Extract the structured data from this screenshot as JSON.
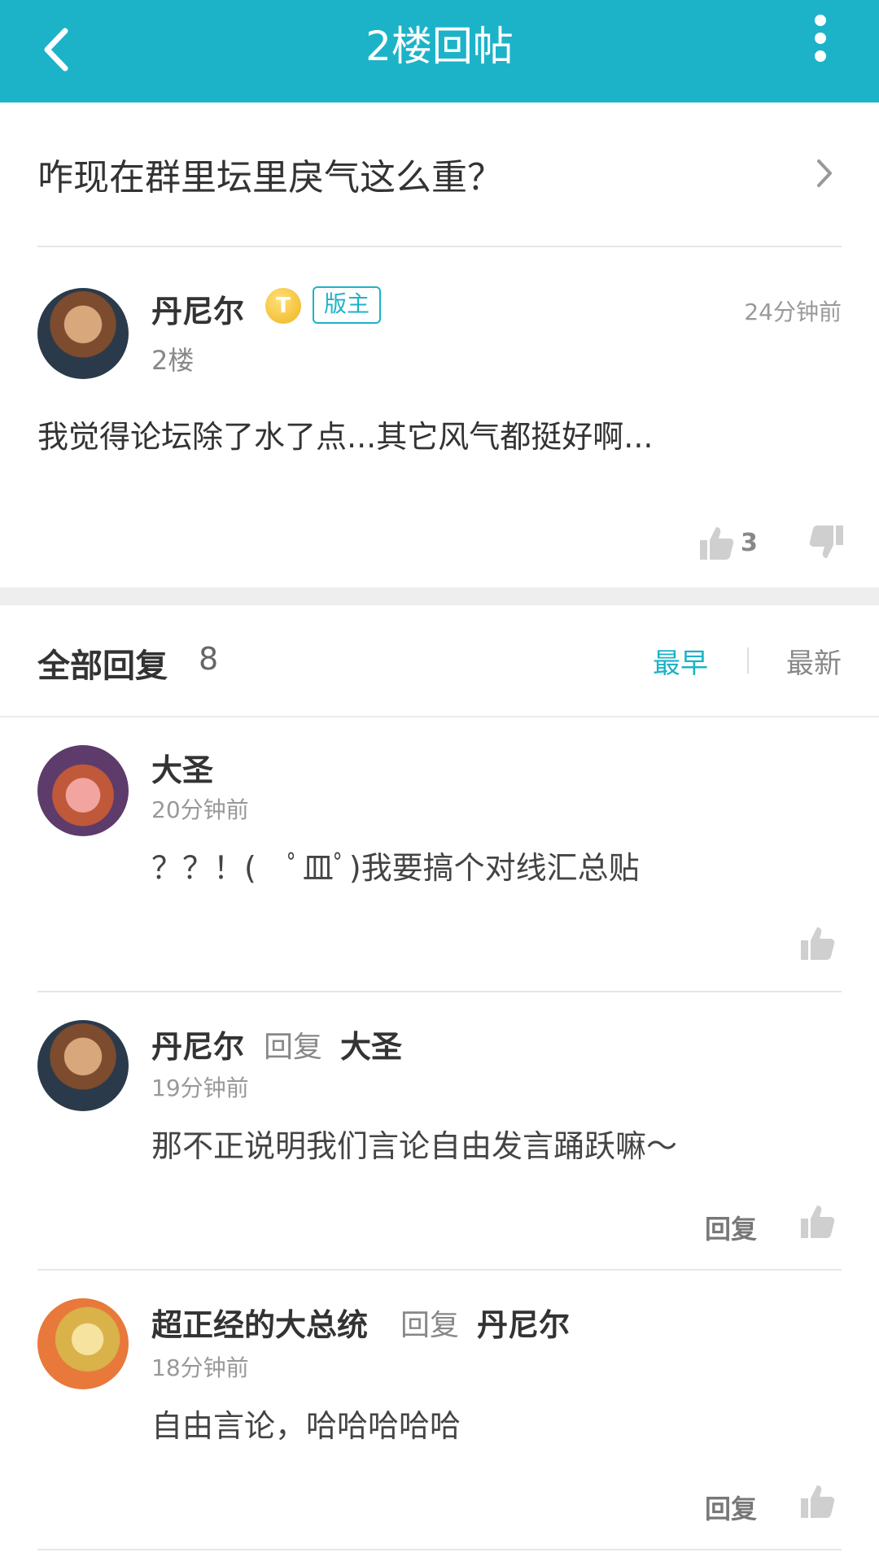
{
  "header": {
    "title": "2楼回帖"
  },
  "thread": {
    "title": "咋现在群里坛里戾气这么重？"
  },
  "post": {
    "author": "丹尼尔",
    "level_badge": "T",
    "role_badge": "版主",
    "floor": "2楼",
    "time": "24分钟前",
    "content": "我觉得论坛除了水了点...其它风气都挺好啊...",
    "like_count": "3"
  },
  "replies_section": {
    "title": "全部回复",
    "count": "8",
    "sort_earliest": "最早",
    "sort_latest": "最新"
  },
  "replies": [
    {
      "author": "大圣",
      "time": "20分钟前",
      "content": "？？！(　ﾟ皿ﾟ)我要搞个对线汇总贴"
    },
    {
      "author": "丹尼尔",
      "reply_word": "回复",
      "reply_to": "大圣",
      "time": "19分钟前",
      "content": "那不正说明我们言论自由发言踊跃嘛～",
      "reply_button": "回复"
    },
    {
      "author": "超正经的大总统",
      "reply_word": "回复",
      "reply_to": "丹尼尔",
      "time": "18分钟前",
      "content": "自由言论，哈哈哈哈哈",
      "reply_button": "回复"
    }
  ],
  "colors": {
    "accent": "#1cb3c8",
    "divider": "#e6e6e6"
  }
}
